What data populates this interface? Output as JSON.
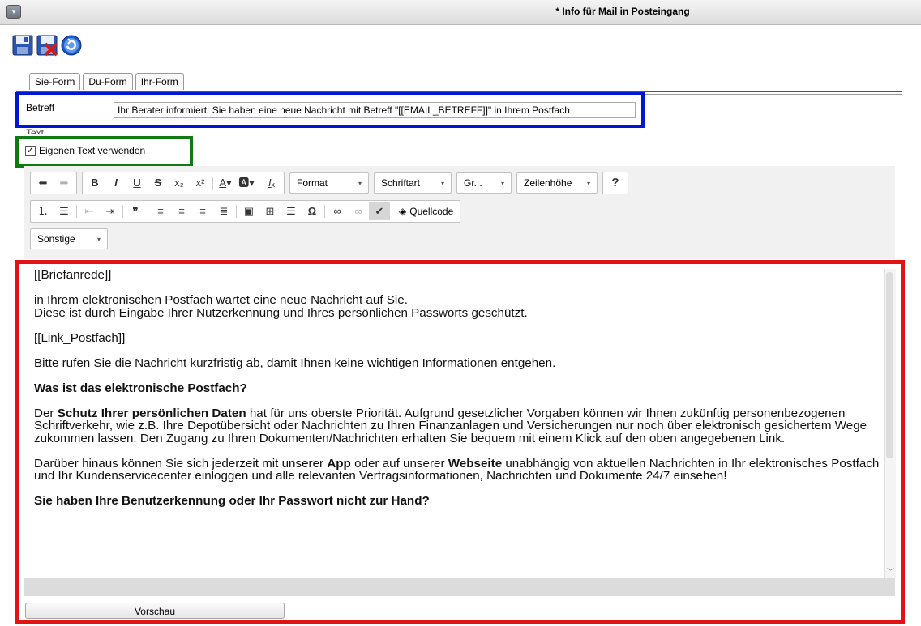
{
  "window": {
    "title": "* Info für Mail in Posteingang"
  },
  "tabs": [
    {
      "label": "Sie-Form"
    },
    {
      "label": "Du-Form"
    },
    {
      "label": "Ihr-Form"
    }
  ],
  "form": {
    "betreff_label": "Betreff",
    "betreff_value": "Ihr Berater informiert: Sie haben eine neue Nachricht mit Betreff \"[[EMAIL_BETREFF]]\" in Ihrem Postfach",
    "text_label": "Text",
    "own_text_label": "Eigenen Text verwenden",
    "own_text_checked": true
  },
  "editor_toolbar": {
    "format_label": "Format",
    "font_label": "Schriftart",
    "size_label": "Gr...",
    "line_height_label": "Zeilenhöhe",
    "help_label": "?",
    "source_label": "Quellcode",
    "other_label": "Sonstige",
    "bold": "B",
    "italic": "I",
    "underline": "U",
    "strike": "S"
  },
  "content": {
    "p1": "[[Briefanrede]]",
    "p2a": "in Ihrem elektronischen Postfach wartet eine neue Nachricht auf Sie.",
    "p2b": "Diese ist durch Eingabe Ihrer Nutzerkennung und Ihres persönlichen Passworts geschützt.",
    "p3": "[[Link_Postfach]]",
    "p4": "Bitte rufen Sie die Nachricht kurzfristig ab, damit Ihnen keine wichtigen Informationen entgehen.",
    "h1": "Was ist das elektronische Postfach?",
    "p5_pre": "Der ",
    "p5_bold": "Schutz Ihrer persönlichen Daten",
    "p5_post": " hat für uns oberste Priorität. Aufgrund gesetzlicher Vorgaben können wir Ihnen zukünftig personenbezogenen Schriftverkehr, wie z.B. Ihre Depotübersicht oder Nachrichten zu Ihren Finanzanlagen und Versicherungen nur noch über elektronisch gesichertem Wege zukommen lassen. Den Zugang zu Ihren Dokumenten/Nachrichten erhalten Sie bequem mit einem Klick auf den oben angegebenen Link.",
    "p6_pre": "Darüber hinaus können Sie sich jederzeit mit unserer ",
    "p6_app": "App",
    "p6_mid": " oder auf unserer ",
    "p6_web": "Webseite",
    "p6_post": " unabhängig von aktuellen Nachrichten in Ihr elektronisches Postfach und Ihr Kundenservicecenter einloggen und alle relevanten Vertragsinformationen, Nachrichten und Dokumente 24/7 einsehen",
    "p6_end": "!",
    "h2": "Sie haben Ihre Benutzerkennung oder Ihr Passwort nicht zur Hand?"
  },
  "preview_label": "Vorschau"
}
